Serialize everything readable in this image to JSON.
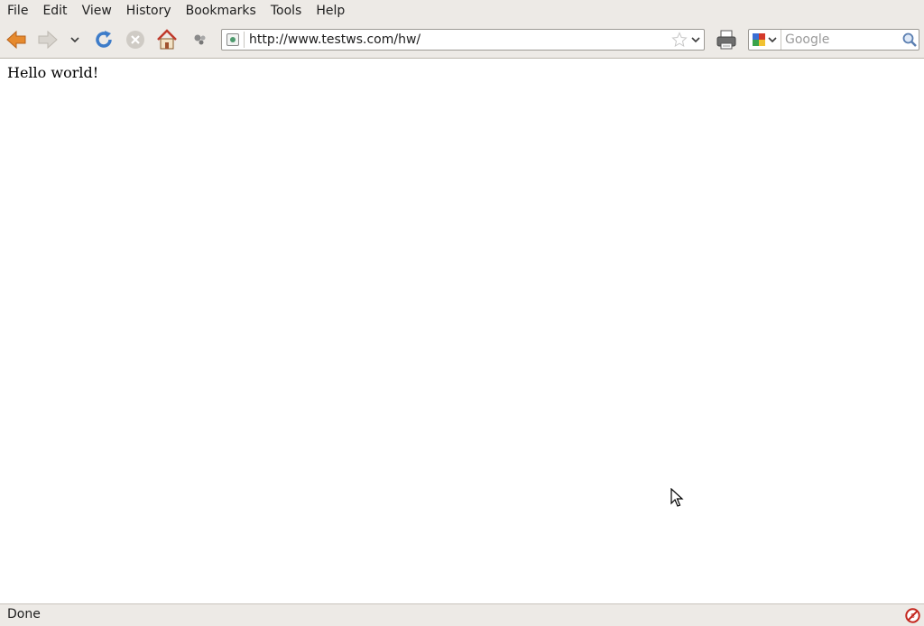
{
  "menubar": {
    "items": [
      {
        "label": "File"
      },
      {
        "label": "Edit"
      },
      {
        "label": "View"
      },
      {
        "label": "History"
      },
      {
        "label": "Bookmarks"
      },
      {
        "label": "Tools"
      },
      {
        "label": "Help"
      }
    ]
  },
  "toolbar": {
    "back_icon": "back-arrow-icon",
    "forward_icon": "forward-arrow-icon",
    "history_dropdown_icon": "chevron-down-icon",
    "reload_icon": "reload-icon",
    "stop_icon": "stop-icon",
    "home_icon": "home-icon",
    "addons_icon": "puzzle-icon",
    "print_icon": "printer-icon"
  },
  "urlbar": {
    "value": "http://www.testws.com/hw/",
    "site_icon": "site-identity-icon",
    "bookmark_icon": "star-icon",
    "dropdown_icon": "chevron-down-icon"
  },
  "searchbar": {
    "placeholder": "Google",
    "engine_icon": "google-icon",
    "go_icon": "magnifier-icon"
  },
  "page": {
    "text": "Hello world!"
  },
  "statusbar": {
    "text": "Done",
    "icon": "blocked-icon"
  },
  "colors": {
    "chrome_bg": "#edeae6",
    "page_bg": "#ffffff",
    "home_red": "#c0392b",
    "back_orange": "#e68a2e",
    "reload_blue": "#3d7cc9"
  }
}
